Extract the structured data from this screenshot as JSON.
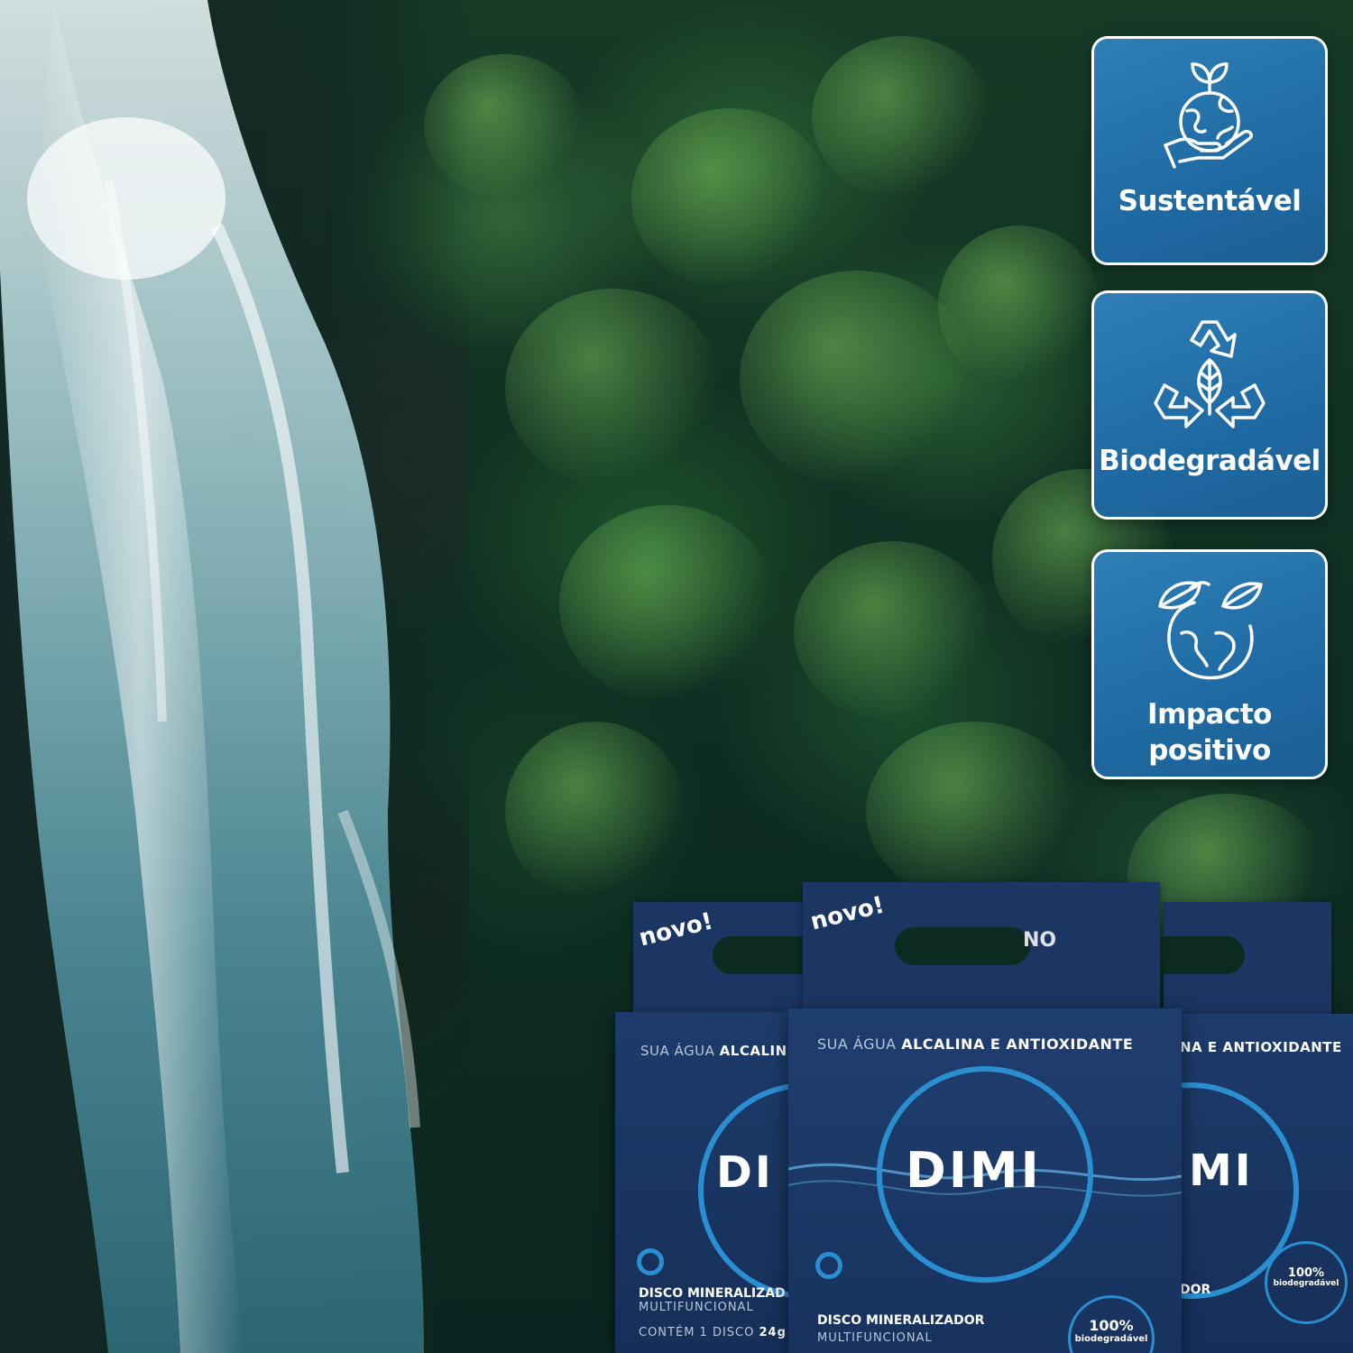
{
  "badges": [
    {
      "label": "Sustentável",
      "icon": "earth-in-hand-icon"
    },
    {
      "label": "Biodegradável",
      "icon": "recycle-leaf-icon"
    },
    {
      "label": "Impacto positivo",
      "icon": "globe-leaves-icon"
    }
  ],
  "product": {
    "novo": "novo!",
    "tagline_pre": "SUA ÁGUA ",
    "tagline_bold": "ALCALINA E ANTIOXIDANTE",
    "left_tagline_pre": "SUA ÁGUA ",
    "left_tagline_bold": "ALCALIN",
    "right_tagline_bold": "NA E ANTIOXIDANTE",
    "brand": "DIMI",
    "left_brand": "DI",
    "right_brand": "MI",
    "right_top_label": "NO",
    "name_line1": "DISCO MINERALIZADOR",
    "name_line2": "MULTIFUNCIONAL",
    "left_name_line1": "DISCO MINERALIZAD",
    "right_name_line1": "DOR",
    "contents_pre": "CONTÉM 1 DISCO ",
    "contents_bold": "24g",
    "seal_pct": "100%",
    "seal_text": "biodegradável"
  },
  "colors": {
    "badge_blue": "#2372ab",
    "box_navy": "#1b3663",
    "accent_blue": "#2a8fd0",
    "forest_green": "#1f5a30"
  }
}
